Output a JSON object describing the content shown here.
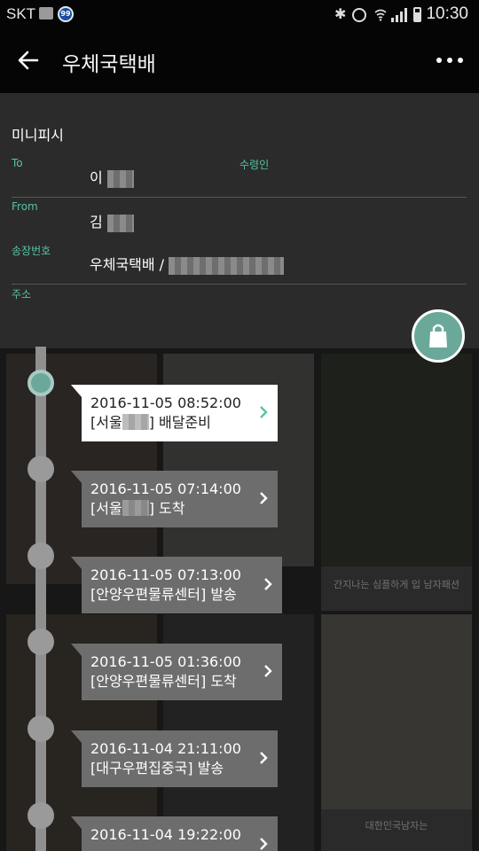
{
  "status_bar": {
    "carrier": "SKT",
    "badge": "99",
    "time": "10:30"
  },
  "app_bar": {
    "title": "우체국택배"
  },
  "info": {
    "item_name": "미니피시",
    "to_label": "To",
    "to_value": "이",
    "recipient_label": "수령인",
    "from_label": "From",
    "from_value": "김",
    "invoice_label": "송장번호",
    "invoice_value": "우체국택배 /",
    "address_label": "주소"
  },
  "background_captions": [
    "간지나는 심플하게 입 남자패션",
    "대한민국남자는"
  ],
  "timeline": [
    {
      "datetime": "2016-11-05 08:52:00",
      "loc_prefix": "[서울",
      "loc_suffix": "] 배달준비",
      "status": ""
    },
    {
      "datetime": "2016-11-05 07:14:00",
      "loc_prefix": "[서울",
      "loc_suffix": "] 도착",
      "status": ""
    },
    {
      "datetime": "2016-11-05 07:13:00",
      "loc_prefix": "[안양우편물류센터] 발송",
      "loc_suffix": "",
      "status": ""
    },
    {
      "datetime": "2016-11-05 01:36:00",
      "loc_prefix": "[안양우편물류센터] 도착",
      "loc_suffix": "",
      "status": ""
    },
    {
      "datetime": "2016-11-04 21:11:00",
      "loc_prefix": "[대구우편집중국] 발송",
      "loc_suffix": "",
      "status": ""
    },
    {
      "datetime": "2016-11-04 19:22:00",
      "loc_prefix": "",
      "loc_suffix": "",
      "status": ""
    }
  ],
  "colors": {
    "accent": "#57c2a6",
    "active_node": "#6aa89a",
    "app_bar": "#050505"
  }
}
